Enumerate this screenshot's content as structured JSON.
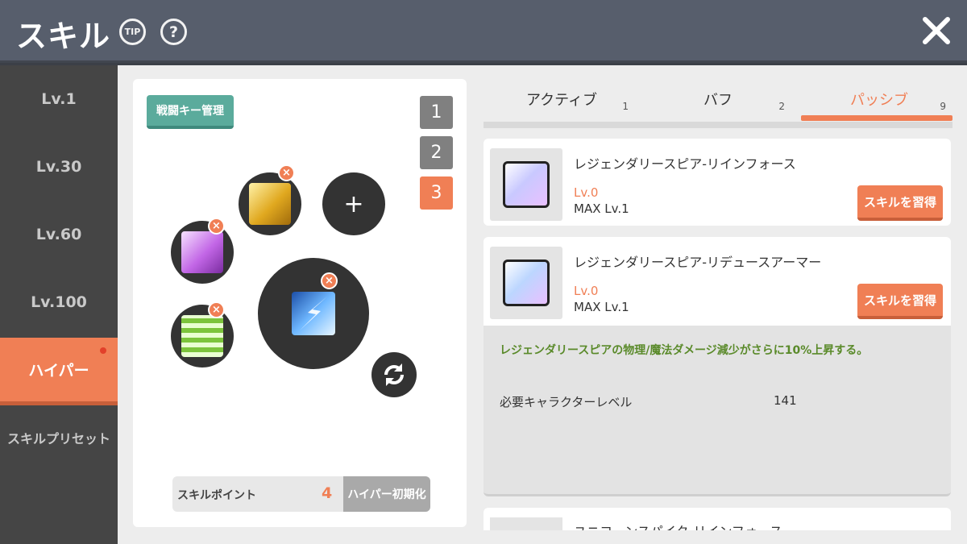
{
  "header": {
    "title": "スキル",
    "tip_label": "TIP",
    "help_label": "?"
  },
  "sidebar": {
    "items": [
      {
        "label": "Lv.1"
      },
      {
        "label": "Lv.30"
      },
      {
        "label": "Lv.60"
      },
      {
        "label": "Lv.100"
      },
      {
        "label": "ハイパー"
      },
      {
        "label": "スキルプリセット"
      }
    ]
  },
  "left_panel": {
    "key_button": "戦闘キー管理",
    "presets": [
      "1",
      "2",
      "3"
    ],
    "add_label": "+",
    "remove_label": "×",
    "skill_point_label": "スキルポイント",
    "skill_point_value": "4",
    "reset_label": "ハイパー初期化"
  },
  "tabs": [
    {
      "label": "アクティブ",
      "count": "1"
    },
    {
      "label": "バフ",
      "count": "2"
    },
    {
      "label": "パッシブ",
      "count": "9"
    }
  ],
  "skills": [
    {
      "name": "レジェンダリースピア-リインフォース",
      "level": "Lv.0",
      "max": "MAX Lv.1",
      "button": "スキルを習得"
    },
    {
      "name": "レジェンダリースピア-リデュースアーマー",
      "level": "Lv.0",
      "max": "MAX Lv.1",
      "button": "スキルを習得"
    }
  ],
  "detail": {
    "description": "レジェンダリースピアの物理/魔法ダメージ減少がさらに10%上昇する。",
    "required_label": "必要キャラクターレベル",
    "required_value": "141"
  },
  "next_skill": {
    "name": "ユニコーンスパイク-リインフォース"
  },
  "colors": {
    "accent": "#f07f55",
    "teal": "#5bab9c",
    "header": "#575e6c",
    "sidebar": "#454545",
    "desc_green": "#5a8a2a"
  }
}
